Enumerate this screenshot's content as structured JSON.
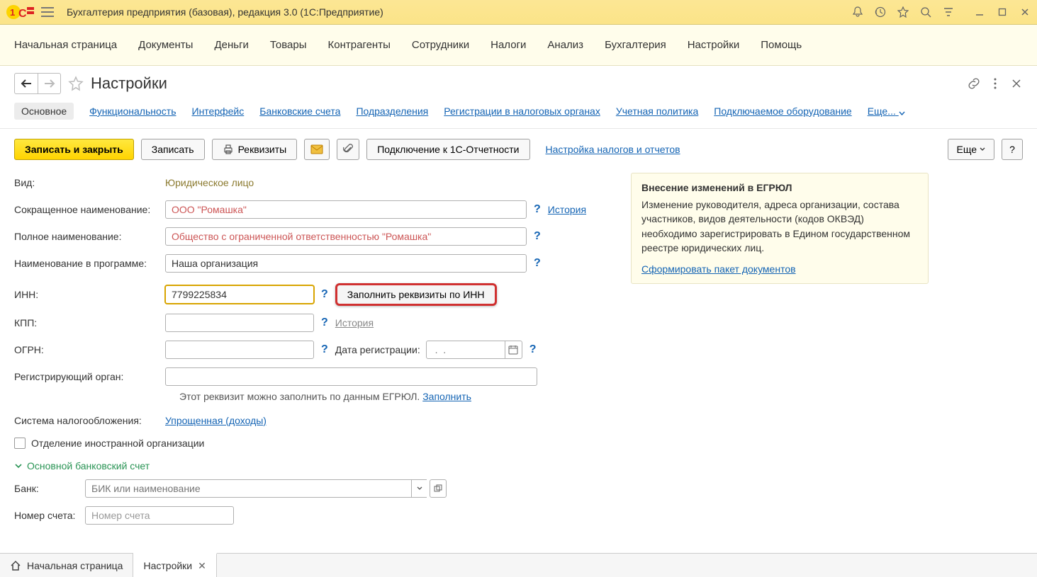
{
  "titlebar": {
    "title": "Бухгалтерия предприятия (базовая), редакция 3.0  (1С:Предприятие)"
  },
  "mainmenu": [
    "Начальная страница",
    "Документы",
    "Деньги",
    "Товары",
    "Контрагенты",
    "Сотрудники",
    "Налоги",
    "Анализ",
    "Бухгалтерия",
    "Настройки",
    "Помощь"
  ],
  "page": {
    "title": "Настройки"
  },
  "tabs": {
    "active": "Основное",
    "items": [
      "Функциональность",
      "Интерфейс",
      "Банковские счета",
      "Подразделения",
      "Регистрации в налоговых органах",
      "Учетная политика",
      "Подключаемое оборудование",
      "Еще..."
    ]
  },
  "toolbar": {
    "save_close": "Записать и закрыть",
    "save": "Записать",
    "props": "Реквизиты",
    "connect": "Подключение к 1С-Отчетности",
    "tax_link": "Настройка налогов и отчетов",
    "more": "Еще",
    "help": "?"
  },
  "form": {
    "kind_label": "Вид:",
    "kind_value": "Юридическое лицо",
    "short_label": "Сокращенное наименование:",
    "short_ph": "ООО \"Ромашка\"",
    "history": "История",
    "full_label": "Полное наименование:",
    "full_ph": "Общество с ограниченной ответственностью \"Ромашка\"",
    "prog_label": "Наименование в программе:",
    "prog_value": "Наша организация",
    "inn_label": "ИНН:",
    "inn_value": "7799225834",
    "fill_by_inn": "Заполнить реквизиты по ИНН",
    "kpp_label": "КПП:",
    "ogrn_label": "ОГРН:",
    "reg_date_label": "Дата регистрации:",
    "reg_date_ph": " .  . ",
    "reg_org_label": "Регистрирующий орган:",
    "reg_hint_text": "Этот реквизит можно заполнить по данным ЕГРЮЛ.",
    "reg_hint_link": "Заполнить",
    "tax_sys_label": "Система налогообложения:",
    "tax_sys_link": "Упрощенная (доходы)",
    "foreign_checkbox": "Отделение иностранной организации",
    "bank_section": "Основной банковский счет",
    "bank_label": "Банк:",
    "bank_ph": "БИК или наименование",
    "acct_label": "Номер счета:",
    "acct_ph": "Номер счета"
  },
  "info": {
    "title": "Внесение изменений в ЕГРЮЛ",
    "text": "Изменение руководителя, адреса организации, состава участников, видов деятельности (кодов ОКВЭД) необходимо зарегистрировать в Едином государственном реестре юридических лиц.",
    "link": "Сформировать пакет документов"
  },
  "bottom_tabs": {
    "home": "Начальная страница",
    "current": "Настройки"
  }
}
